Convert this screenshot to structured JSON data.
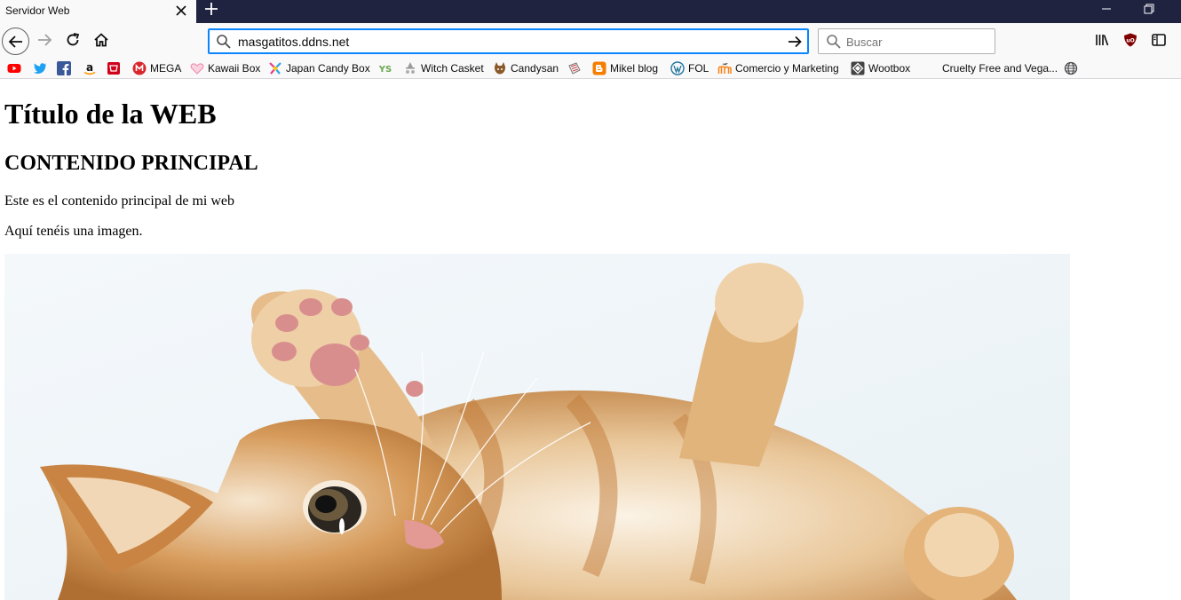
{
  "window": {
    "tab_title": "Servidor Web"
  },
  "toolbar": {
    "url": "masgatitos.ddns.net",
    "search_placeholder": "Buscar"
  },
  "bookmarks": [
    {
      "label": "",
      "icon": "youtube-icon",
      "color": "#ff0000"
    },
    {
      "label": "",
      "icon": "twitter-icon",
      "color": "#1da1f2"
    },
    {
      "label": "",
      "icon": "facebook-icon",
      "color": "#3b5998"
    },
    {
      "label": "",
      "icon": "amazon-icon",
      "color": "#ff9900"
    },
    {
      "label": "",
      "icon": "shop-icon",
      "color": "#d0021b"
    },
    {
      "label": "MEGA",
      "icon": "mega-icon",
      "color": "#d9272e"
    },
    {
      "label": "Kawaii Box",
      "icon": "heart-icon",
      "color": "#f4a7c0"
    },
    {
      "label": "Japan Candy Box",
      "icon": "candy-icon",
      "color": "#e83e8c"
    },
    {
      "label": "",
      "icon": "ys-icon",
      "color": "#6aa84f"
    },
    {
      "label": "Witch Casket",
      "icon": "witch-icon",
      "color": "#7a7a7a"
    },
    {
      "label": "Candysan",
      "icon": "candysan-icon",
      "color": "#8b5a2b"
    },
    {
      "label": "",
      "icon": "sticker-icon",
      "color": "#888888"
    },
    {
      "label": "Mikel blog",
      "icon": "blogger-icon",
      "color": "#f57d00"
    },
    {
      "label": "FOL",
      "icon": "wordpress-icon",
      "color": "#21759b"
    },
    {
      "label": "Comercio y Marketing",
      "icon": "moodle-icon",
      "color": "#f98012"
    },
    {
      "label": "Wootbox",
      "icon": "wootbox-icon",
      "color": "#444444"
    },
    {
      "label": "Cruelty Free and Vega...",
      "icon": "",
      "color": ""
    },
    {
      "label": "",
      "icon": "globe-icon",
      "color": "#4a4a4f"
    }
  ],
  "page": {
    "title": "Título de la WEB",
    "heading": "CONTENIDO PRINCIPAL",
    "paragraph1": "Este es el contenido principal de mi web",
    "paragraph2": "Aquí tenéis una imagen."
  },
  "colors": {
    "titlebar": "#202340",
    "accent": "#0a84ff"
  }
}
